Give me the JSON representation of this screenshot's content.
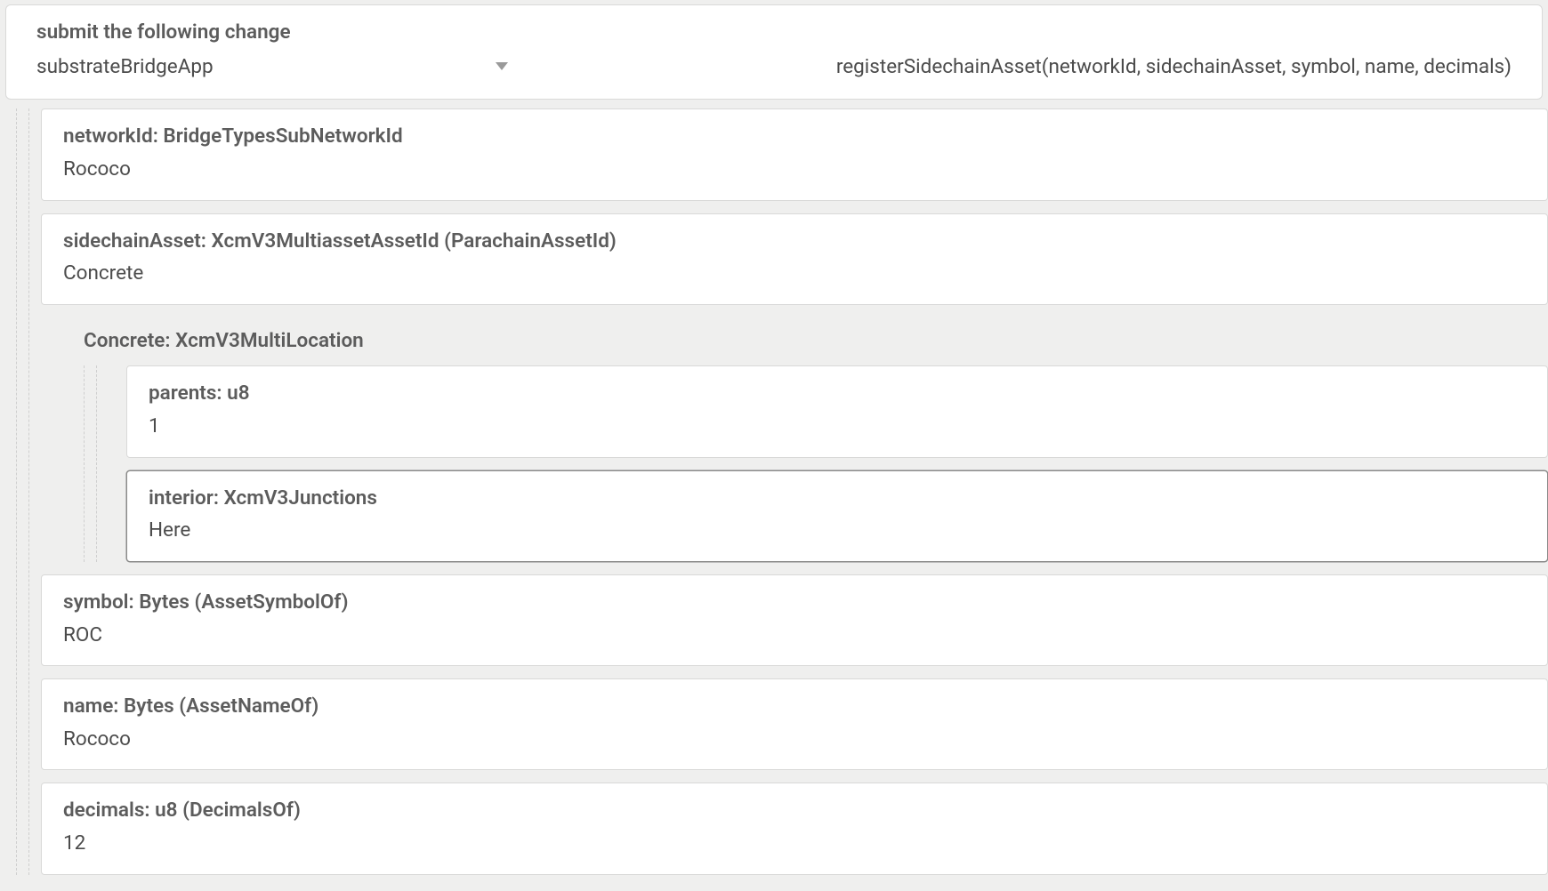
{
  "header": {
    "title": "submit the following change",
    "module": "substrateBridgeApp",
    "method": "registerSidechainAsset(networkId, sidechainAsset, symbol, name, decimals)"
  },
  "params": {
    "networkId": {
      "label": "networkId: BridgeTypesSubNetworkId",
      "value": "Rococo"
    },
    "sidechainAsset": {
      "label": "sidechainAsset: XcmV3MultiassetAssetId (ParachainAssetId)",
      "value": "Concrete",
      "concrete": {
        "label": "Concrete: XcmV3MultiLocation",
        "parents": {
          "label": "parents: u8",
          "value": "1"
        },
        "interior": {
          "label": "interior: XcmV3Junctions",
          "value": "Here"
        }
      }
    },
    "symbol": {
      "label": "symbol: Bytes (AssetSymbolOf)",
      "value": "ROC"
    },
    "name": {
      "label": "name: Bytes (AssetNameOf)",
      "value": "Rococo"
    },
    "decimals": {
      "label": "decimals: u8 (DecimalsOf)",
      "value": "12"
    }
  }
}
